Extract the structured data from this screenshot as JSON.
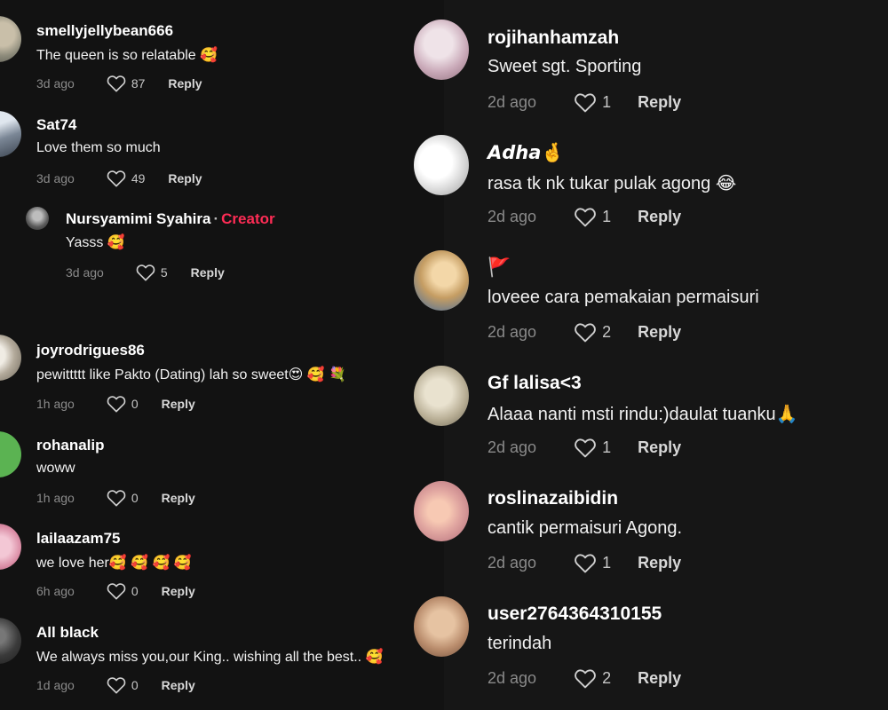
{
  "left": {
    "comments": [
      {
        "username": "smellyjellybean666",
        "text": "The queen is so relatable 🥰",
        "date": "3d ago",
        "likes": "87",
        "reply": "Reply"
      },
      {
        "username": "Sat74",
        "text": "Love them so much",
        "date": "3d ago",
        "likes": "49",
        "reply": "Reply"
      },
      {
        "username": "Nursyamimi Syahira",
        "badge": "Creator",
        "separator": "·",
        "text": "Yasss 🥰",
        "date": "3d ago",
        "likes": "5",
        "reply": "Reply"
      },
      {
        "username": "joyrodrigues86",
        "text": "pewittttt like Pakto (Dating) lah so sweet😍 🥰 💐",
        "date": "1h ago",
        "likes": "0",
        "reply": "Reply"
      },
      {
        "username": "rohanalip",
        "text": "woww",
        "date": "1h ago",
        "likes": "0",
        "reply": "Reply"
      },
      {
        "username": "lailaazam75",
        "text": "we love her🥰 🥰 🥰 🥰",
        "date": "6h ago",
        "likes": "0",
        "reply": "Reply"
      },
      {
        "username": "All black",
        "text": "We always miss you,our King.. wishing all the best.. 🥰",
        "date": "1d ago",
        "likes": "0",
        "reply": "Reply"
      }
    ]
  },
  "right": {
    "comments": [
      {
        "username": "rojihanhamzah",
        "text": "Sweet sgt. Sporting",
        "date": "2d ago",
        "likes": "1",
        "reply": "Reply"
      },
      {
        "username": "𝘼𝙙𝙝𝙖🤞",
        "text": "rasa tk nk tukar pulak agong 😂",
        "date": "2d ago",
        "likes": "1",
        "reply": "Reply"
      },
      {
        "username": "🚩",
        "text": "loveee cara pemakaian permaisuri",
        "date": "2d ago",
        "likes": "2",
        "reply": "Reply"
      },
      {
        "username": "Gf lalisa<3",
        "text": "Alaaa nanti msti rindu:)daulat tuanku🙏",
        "date": "2d ago",
        "likes": "1",
        "reply": "Reply"
      },
      {
        "username": "roslinazaibidin",
        "text": "cantik permaisuri Agong.",
        "date": "2d ago",
        "likes": "1",
        "reply": "Reply"
      },
      {
        "username": "user2764364310155",
        "text": "terindah",
        "date": "2d ago",
        "likes": "2",
        "reply": "Reply"
      }
    ]
  },
  "colors": {
    "background": "#121212",
    "creator_badge": "#fe2c55",
    "muted": "#8a8a8a"
  },
  "icons": {
    "like": "heart-outline-icon"
  }
}
